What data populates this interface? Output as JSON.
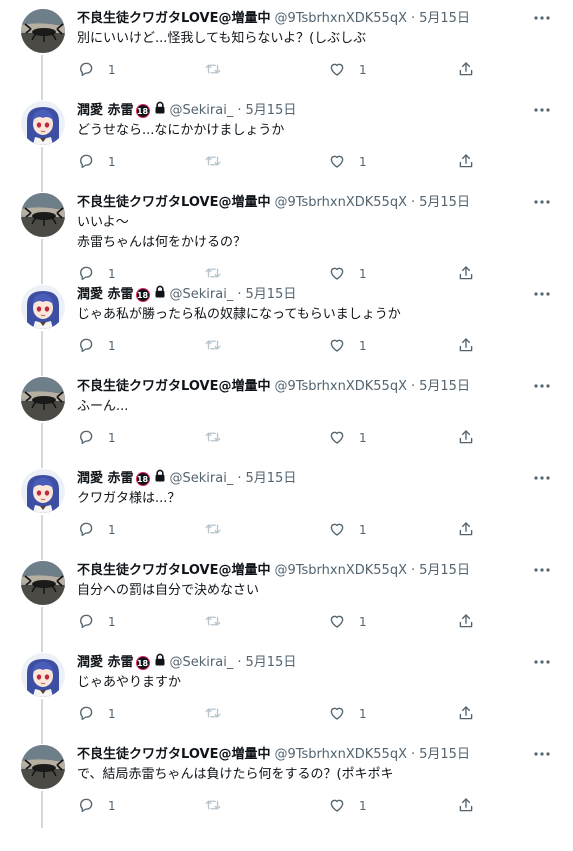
{
  "users": {
    "a": {
      "name": "不良生徒クワガタLOVE@増量中",
      "handle": "@9TsbrhxnXDK55qX",
      "avatar_icon": "beetle-avatar-icon"
    },
    "b": {
      "name": "潤愛 赤雷",
      "handle": "@Sekirai_",
      "badge": "18",
      "avatar_icon": "anime-girl-avatar-icon"
    }
  },
  "separator": "·",
  "tweets": [
    {
      "user": "a",
      "date": "5月15日",
      "text": "別にいいけど...怪我しても知らないよ？(しぶしぶ",
      "reply_count": "1",
      "retweet_count": "",
      "like_count": "1"
    },
    {
      "user": "b",
      "date": "5月15日",
      "text": "どうせなら...なにかかけましょうか",
      "reply_count": "1",
      "retweet_count": "",
      "like_count": "1"
    },
    {
      "user": "a",
      "date": "5月15日",
      "text": "いいよ～\n赤雷ちゃんは何をかけるの？",
      "reply_count": "1",
      "retweet_count": "",
      "like_count": "1"
    },
    {
      "user": "b",
      "date": "5月15日",
      "text": "じゃあ私が勝ったら私の奴隷になってもらいましょうか",
      "reply_count": "1",
      "retweet_count": "",
      "like_count": "1"
    },
    {
      "user": "a",
      "date": "5月15日",
      "text": "ふーん...",
      "reply_count": "1",
      "retweet_count": "",
      "like_count": "1"
    },
    {
      "user": "b",
      "date": "5月15日",
      "text": "クワガタ様は...？",
      "reply_count": "1",
      "retweet_count": "",
      "like_count": "1"
    },
    {
      "user": "a",
      "date": "5月15日",
      "text": "自分への罰は自分で決めなさい",
      "reply_count": "1",
      "retweet_count": "",
      "like_count": "1"
    },
    {
      "user": "b",
      "date": "5月15日",
      "text": "じゃあやりますか",
      "reply_count": "1",
      "retweet_count": "",
      "like_count": "1"
    },
    {
      "user": "a",
      "date": "5月15日",
      "text": "で、結局赤雷ちゃんは負けたら何をするの？(ポキポキ",
      "reply_count": "1",
      "retweet_count": "",
      "like_count": "1"
    }
  ]
}
